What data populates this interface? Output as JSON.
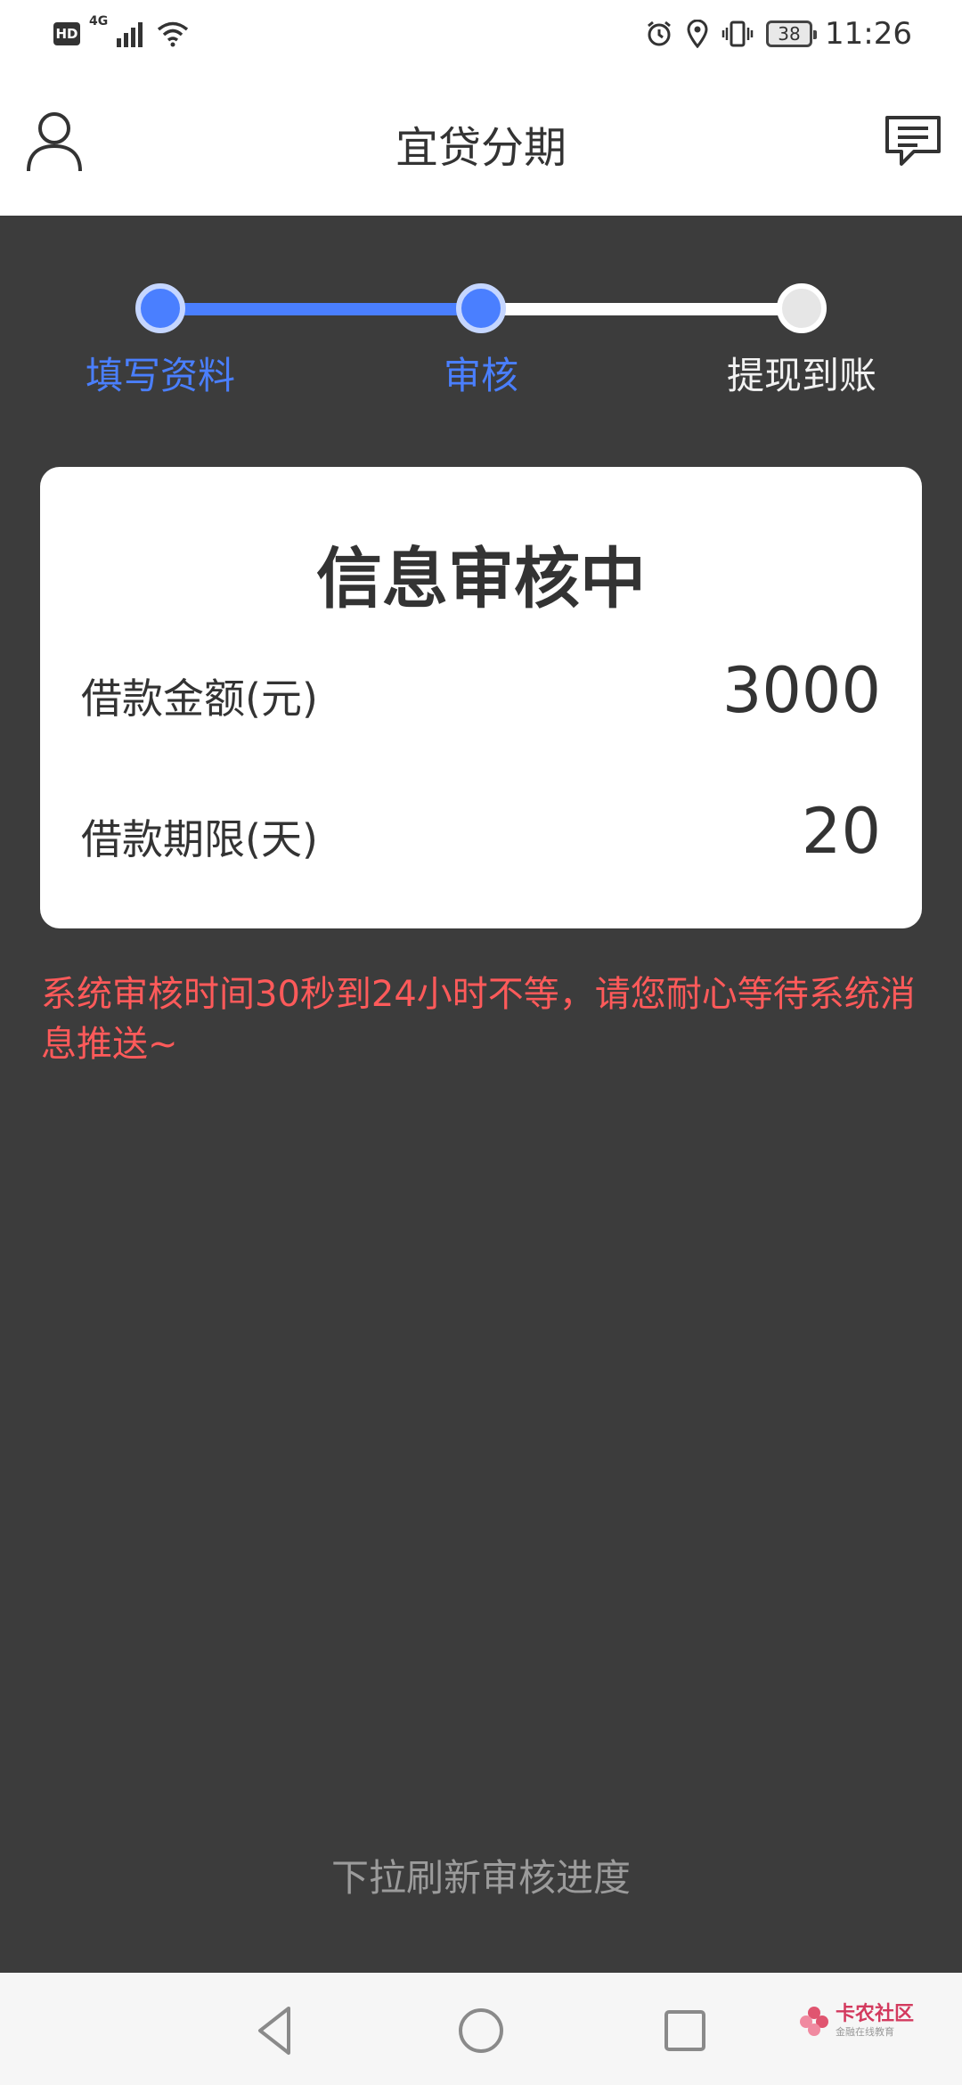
{
  "status_bar": {
    "hd_label": "HD",
    "network_label": "4G",
    "battery_level": "38",
    "time": "11:26"
  },
  "header": {
    "title": "宜贷分期",
    "left_icon": "user-icon",
    "right_icon": "message-icon"
  },
  "steps": {
    "items": [
      {
        "label": "填写资料",
        "state": "done"
      },
      {
        "label": "审核",
        "state": "active"
      },
      {
        "label": "提现到账",
        "state": "pending"
      }
    ]
  },
  "card": {
    "title": "信息审核中",
    "rows": [
      {
        "label": "借款金额(元)",
        "value": "3000"
      },
      {
        "label": "借款期限(天)",
        "value": "20"
      }
    ]
  },
  "notice": "系统审核时间30秒到24小时不等，请您耐心等待系统消息推送~",
  "refresh_hint": "下拉刷新审核进度",
  "watermark": {
    "main": "卡农社区",
    "sub": "金融在线教育"
  },
  "colors": {
    "accent": "#4a7fff",
    "notice": "#ff5a5a",
    "background": "#3c3c3c"
  }
}
